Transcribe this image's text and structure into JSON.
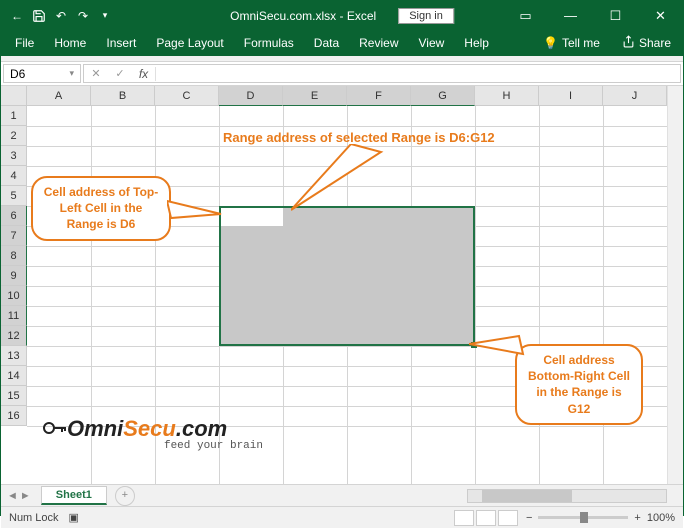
{
  "titlebar": {
    "document_title": "OmniSecu.com.xlsx - Excel",
    "signin_label": "Sign in"
  },
  "ribbon": {
    "tabs": [
      "File",
      "Home",
      "Insert",
      "Page Layout",
      "Formulas",
      "Data",
      "Review",
      "View",
      "Help"
    ],
    "tellme": "Tell me",
    "share": "Share"
  },
  "formula_bar": {
    "name_box_value": "D6",
    "fx_label": "fx",
    "formula_value": ""
  },
  "grid": {
    "columns": [
      "A",
      "B",
      "C",
      "D",
      "E",
      "F",
      "G",
      "H",
      "I",
      "J"
    ],
    "rows": [
      "1",
      "2",
      "3",
      "4",
      "5",
      "6",
      "7",
      "8",
      "9",
      "10",
      "11",
      "12",
      "13",
      "14",
      "15",
      "16"
    ],
    "selected_cols": [
      "D",
      "E",
      "F",
      "G"
    ],
    "selected_rows": [
      "6",
      "7",
      "8",
      "9",
      "10",
      "11",
      "12"
    ],
    "selection_range": "D6:G12",
    "active_cell": "D6"
  },
  "annotations": {
    "range_text": "Range  address of selected Range is D6:G12",
    "topleft_callout": "Cell address of Top-Left Cell in the Range is D6",
    "bottomright_callout": "Cell address Bottom-Right Cell in the Range is G12"
  },
  "logo": {
    "brand_prefix": "O",
    "brand_mid": "mni",
    "brand_accent": "Secu",
    "brand_suffix": ".com",
    "tagline": "feed your brain"
  },
  "sheet_bar": {
    "active_sheet": "Sheet1"
  },
  "status_bar": {
    "left_text": "Num Lock",
    "zoom_label": "100%"
  }
}
